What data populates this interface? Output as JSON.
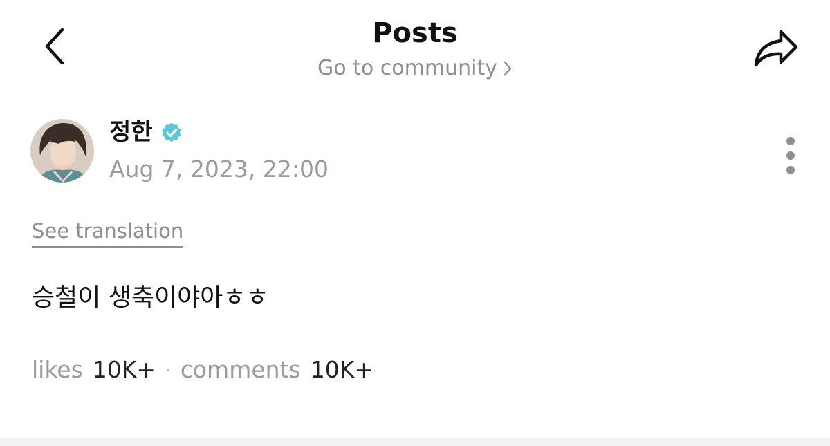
{
  "header": {
    "title": "Posts",
    "community_link": "Go to community"
  },
  "post": {
    "author": "정한",
    "verified": true,
    "date": "Aug 7, 2023, 22:00",
    "translate_label": "See translation",
    "body": "승철이 생축이야아ㅎㅎ"
  },
  "stats": {
    "likes_label": "likes",
    "likes_value": "10K+",
    "separator": "·",
    "comments_label": "comments",
    "comments_value": "10K+"
  },
  "colors": {
    "verified_badge": "#5bc6d8",
    "muted_text": "#8e8e93"
  },
  "icons": {
    "back": "chevron-left-icon",
    "share": "share-arrow-icon",
    "community_chevron": "chevron-right-icon",
    "more": "more-vertical-icon",
    "verified": "verified-badge-icon"
  }
}
